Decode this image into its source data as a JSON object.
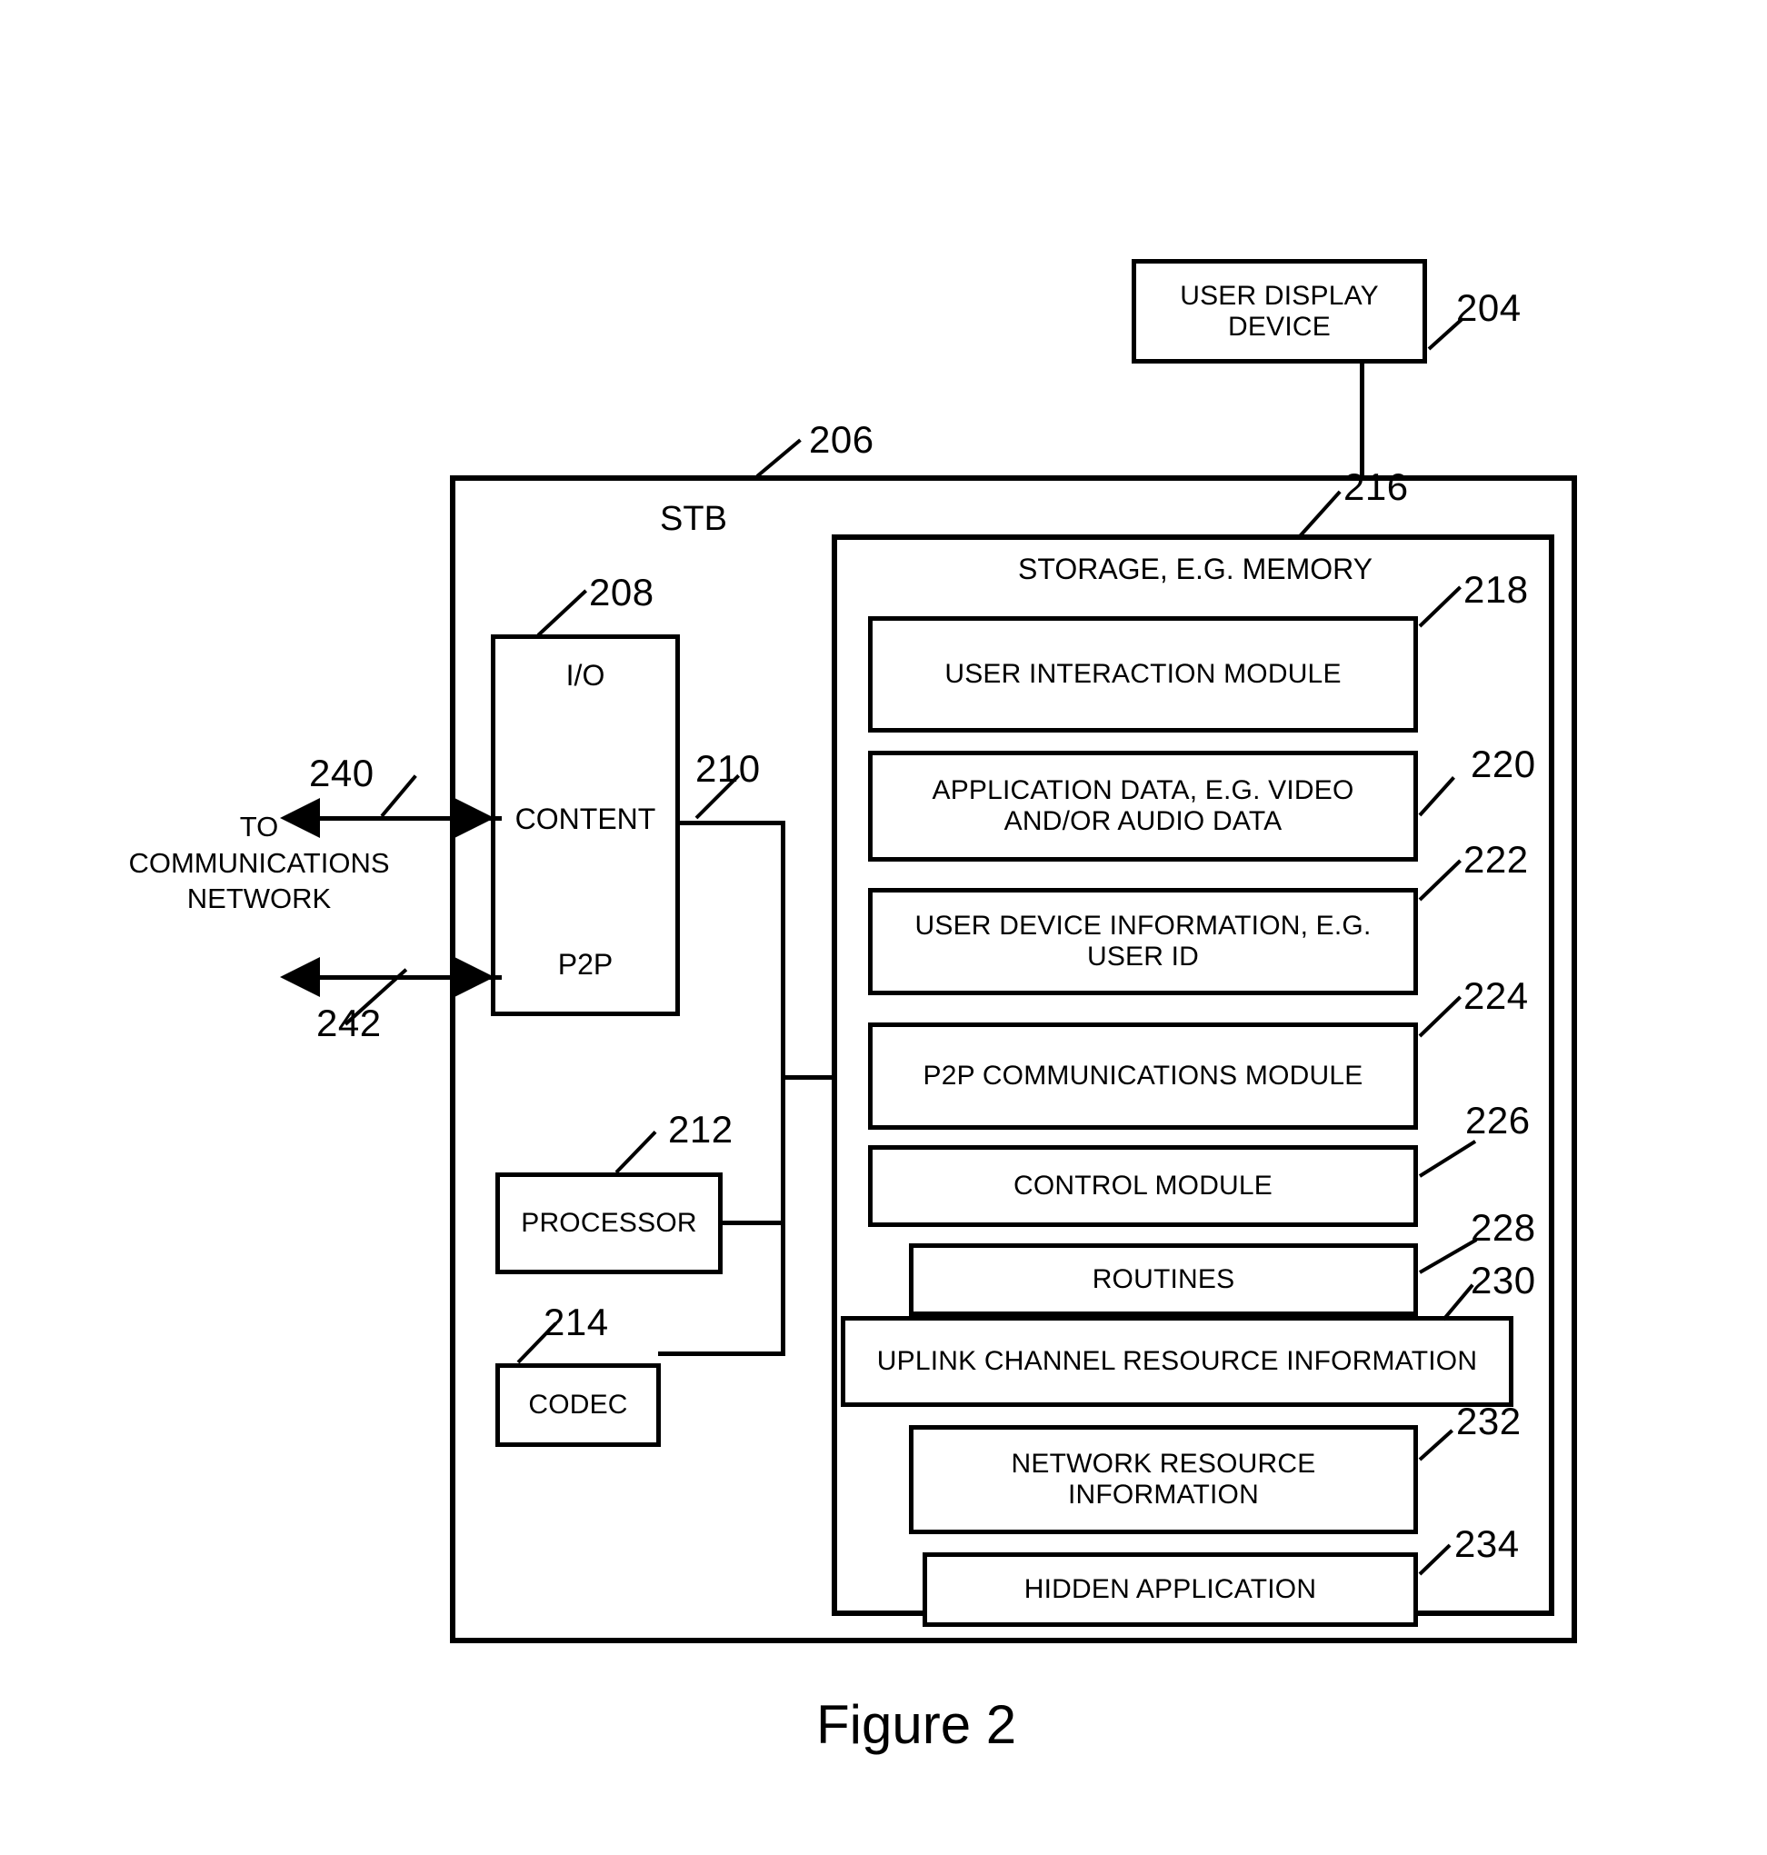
{
  "figure": {
    "caption": "Figure 2"
  },
  "display_device": {
    "label": "USER DISPLAY\nDEVICE",
    "ref": "204"
  },
  "stb": {
    "label": "STB",
    "ref": "206"
  },
  "io": {
    "title": "I/O",
    "content_label": "CONTENT",
    "p2p_label": "P2P",
    "ref": "208",
    "bus_ref": "210"
  },
  "processor": {
    "label": "PROCESSOR",
    "ref": "212"
  },
  "codec": {
    "label": "CODEC",
    "ref": "214"
  },
  "network": {
    "label": "TO\nCOMMUNICATIONS\nNETWORK",
    "content_link_ref": "240",
    "p2p_link_ref": "242"
  },
  "storage": {
    "label": "STORAGE, E.G. MEMORY",
    "ref": "216",
    "modules": [
      {
        "label": "USER INTERACTION MODULE",
        "ref": "218"
      },
      {
        "label": "APPLICATION DATA, E.G. VIDEO\nAND/OR AUDIO DATA",
        "ref": "220"
      },
      {
        "label": "USER DEVICE INFORMATION, E.G.\nUSER ID",
        "ref": "222"
      },
      {
        "label": "P2P COMMUNICATIONS MODULE",
        "ref": "224"
      },
      {
        "label": "CONTROL MODULE",
        "ref": "226"
      },
      {
        "label": "ROUTINES",
        "ref": "228"
      },
      {
        "label": "UPLINK CHANNEL RESOURCE INFORMATION",
        "ref": "230"
      },
      {
        "label": "NETWORK RESOURCE\nINFORMATION",
        "ref": "232"
      },
      {
        "label": "HIDDEN APPLICATION",
        "ref": "234"
      }
    ]
  }
}
